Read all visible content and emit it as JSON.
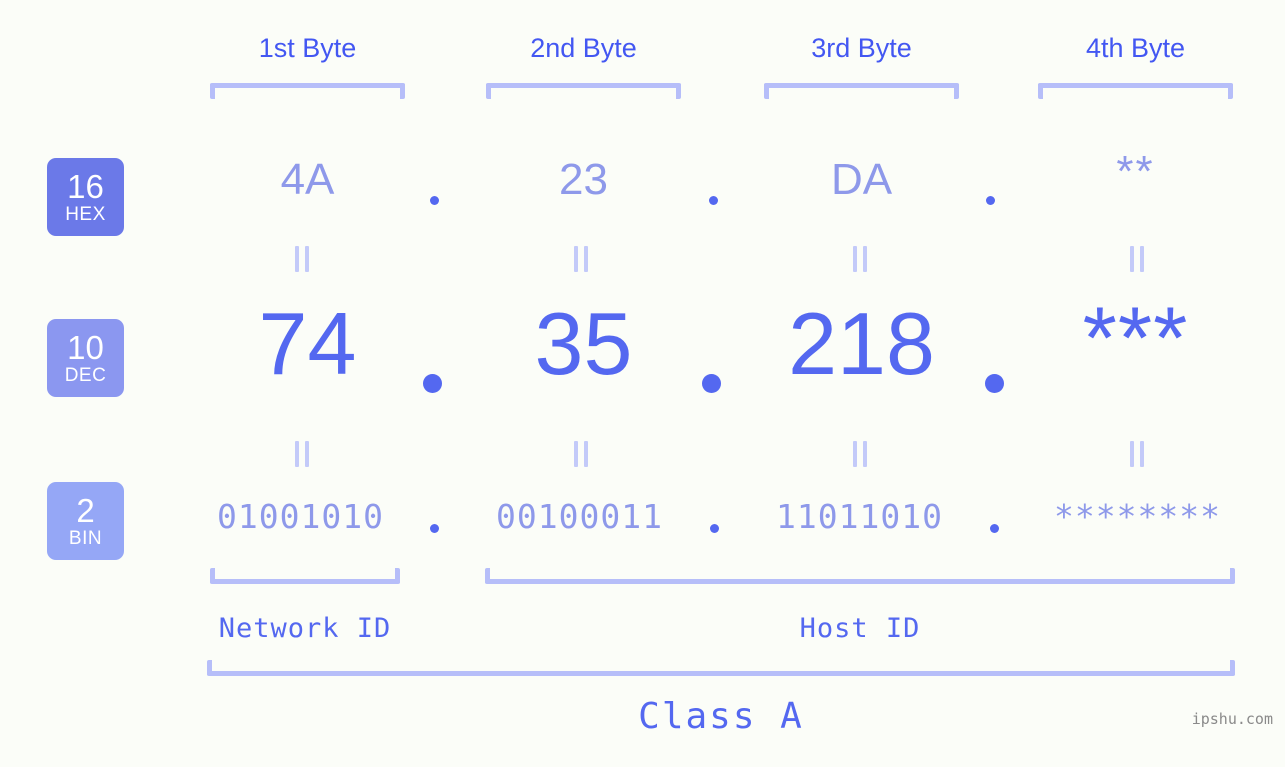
{
  "theme": {
    "background": "#fbfdf8",
    "accent_strong": "#4357f2",
    "accent": "#5468f0",
    "accent_soft": "#8e99ea",
    "bracket": "#b6bef9",
    "equals": "#c3caf9",
    "badge_hex": "#6b79e8",
    "badge_dec": "#8b97f0",
    "badge_bin": "#95a7f6",
    "watermark": "#8a8a8a"
  },
  "bases": [
    {
      "num": "16",
      "name": "HEX"
    },
    {
      "num": "10",
      "name": "DEC"
    },
    {
      "num": "2",
      "name": "BIN"
    }
  ],
  "byte_headers": [
    {
      "label": "1st Byte"
    },
    {
      "label": "2nd Byte"
    },
    {
      "label": "3rd Byte"
    },
    {
      "label": "4th Byte"
    }
  ],
  "rows": {
    "hex": {
      "base_label": "HEX",
      "base_num": "16",
      "values": [
        "4A",
        "23",
        "DA",
        "**"
      ]
    },
    "dec": {
      "base_label": "DEC",
      "base_num": "10",
      "values": [
        "74",
        "35",
        "218",
        "***"
      ]
    },
    "bin": {
      "base_label": "BIN",
      "base_num": "2",
      "values": [
        "01001010",
        "00100011",
        "11011010",
        "********"
      ]
    }
  },
  "separators": {
    "glyph": ".",
    "count": 3
  },
  "equals_marks": {
    "glyph": "=",
    "rows": 2,
    "per_row": 4
  },
  "regions": [
    {
      "label": "Network ID",
      "bytes": 1
    },
    {
      "label": "Host ID",
      "bytes": 3
    }
  ],
  "class": {
    "label": "Class A"
  },
  "watermark": {
    "text": "ipshu.com"
  }
}
